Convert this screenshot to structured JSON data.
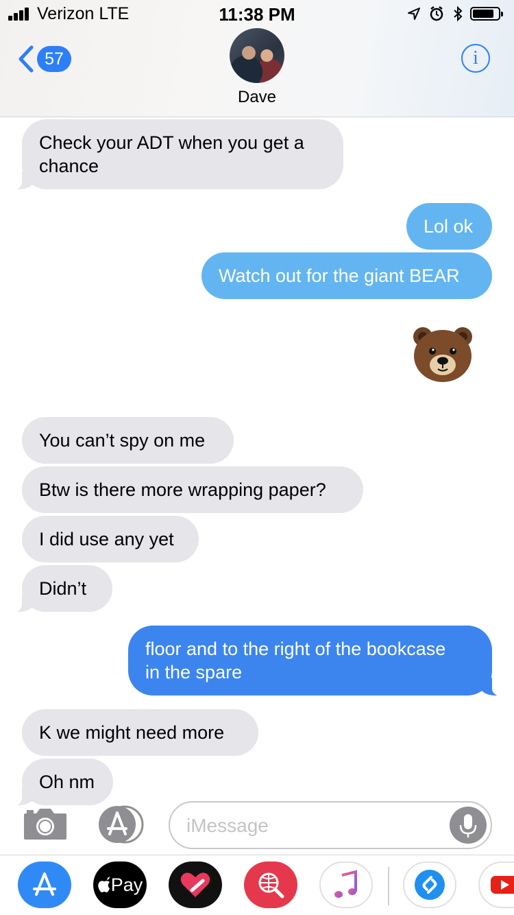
{
  "status_bar": {
    "carrier": "Verizon  LTE",
    "time": "11:38 PM",
    "signal_bars": 4,
    "battery_level": 0.85
  },
  "nav": {
    "back_count": "57",
    "contact_name": "Dave",
    "info_label": "i"
  },
  "messages": [
    {
      "from": "contact",
      "text_lines": [
        "Check your ADT when you get a",
        "chance"
      ]
    },
    {
      "from": "me",
      "kind": "sms",
      "text": "Lol ok"
    },
    {
      "from": "me",
      "kind": "sms",
      "text": "Watch out for the giant BEAR"
    },
    {
      "from": "me",
      "kind": "emoji",
      "emoji": "bear-face"
    },
    {
      "from": "contact",
      "text": "You can’t spy on me"
    },
    {
      "from": "contact",
      "text": "Btw is there more wrapping paper?"
    },
    {
      "from": "contact",
      "text": "I did use any yet"
    },
    {
      "from": "contact",
      "text": "Didn’t"
    },
    {
      "from": "me",
      "kind": "imessage",
      "text_lines": [
        "floor and to the right of the bookcase",
        "in the spare"
      ]
    },
    {
      "from": "contact",
      "text": "K we might need more"
    },
    {
      "from": "contact",
      "text": "Oh nm"
    }
  ],
  "input_bar": {
    "placeholder": "iMessage",
    "camera_icon": "camera-icon",
    "apps_icon": "app-store-icon",
    "mic_icon": "microphone-icon"
  },
  "app_drawer": [
    {
      "name": "app-store",
      "icon": "app-store-icon"
    },
    {
      "name": "apple-pay",
      "label": "Pay",
      "icon": "apple-logo-icon"
    },
    {
      "name": "digital-touch",
      "icon": "heart-icon"
    },
    {
      "name": "images-search",
      "icon": "globe-search-icon"
    },
    {
      "name": "music",
      "icon": "music-note-icon"
    },
    {
      "name": "shazam",
      "icon": "shazam-icon"
    },
    {
      "name": "youtube",
      "icon": "play-icon"
    }
  ],
  "colors": {
    "imessage_blue": "#3c85ee",
    "sms_blue": "#63b5f1",
    "incoming_gray": "#e5e5ea",
    "ios_blue": "#2d7ff7"
  }
}
